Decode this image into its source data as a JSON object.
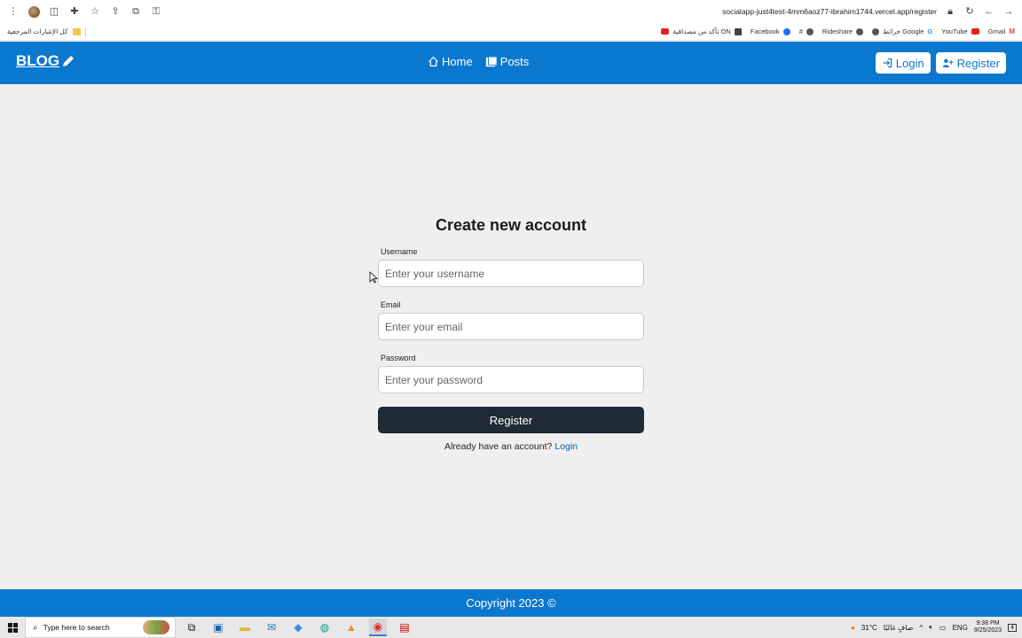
{
  "browser": {
    "url": "socialapp-just4test-4mm6aoz77-ibrahim1744.vercel.app/register"
  },
  "bookmarks": {
    "all_bookmarks": "كل الإشارات المرجعية",
    "items": [
      {
        "label": "Gmail"
      },
      {
        "label": "YouTube"
      },
      {
        "label": "خرائط Google"
      },
      {
        "label": "Rideshare"
      },
      {
        "label": "#"
      },
      {
        "label": "Facebook"
      },
      {
        "label": "تأكد من مصداقية ON"
      }
    ]
  },
  "navbar": {
    "brand": "BLOG",
    "home": "Home",
    "posts": "Posts",
    "login": "Login",
    "register": "Register"
  },
  "form": {
    "title": "Create new account",
    "username_label": "Username",
    "username_placeholder": "Enter your username",
    "email_label": "Email",
    "email_placeholder": "Enter your email",
    "password_label": "Password",
    "password_placeholder": "Enter your password",
    "submit": "Register",
    "hint": "Already have an account?",
    "hint_link": "Login"
  },
  "footer": {
    "copyright": "Copyright 2023 ©"
  },
  "taskbar": {
    "search_placeholder": "Type here to search",
    "weather": "31°C",
    "weather_desc": "صافٍ غالبًا",
    "lang": "ENG",
    "time": "9:38 PM",
    "date": "9/25/2023",
    "notifications": "4"
  },
  "colors": {
    "primary": "#0b78d0",
    "dark_button": "#1e2a36",
    "background": "#efefef"
  }
}
